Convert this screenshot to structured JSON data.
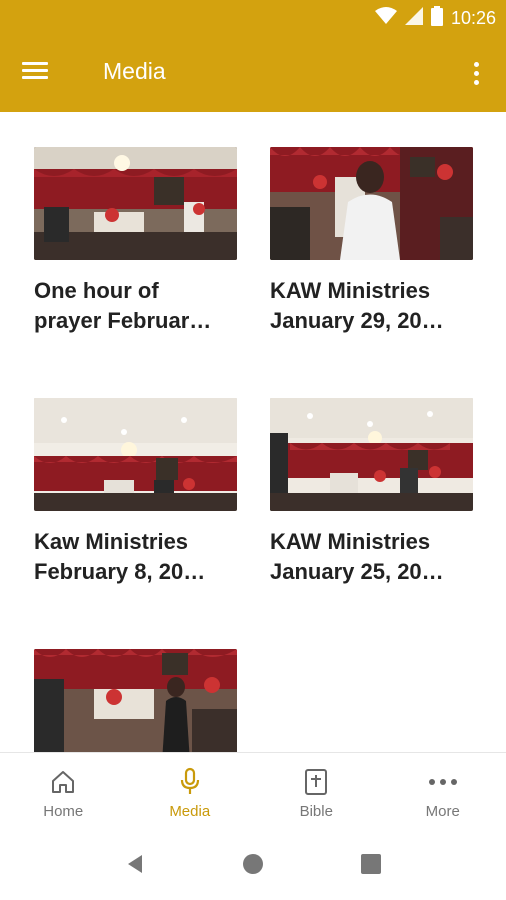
{
  "status": {
    "time": "10:26"
  },
  "appbar": {
    "title": "Media"
  },
  "colors": {
    "accent": "#D3A20F",
    "active_nav": "#C99A0B"
  },
  "media": [
    {
      "title_line1": "One hour of",
      "title_line2": "prayer Februar…"
    },
    {
      "title_line1": "KAW Ministries",
      "title_line2": "January 29, 20…"
    },
    {
      "title_line1": "Kaw Ministries",
      "title_line2": "February 8, 20…"
    },
    {
      "title_line1": "KAW Ministries",
      "title_line2": "January 25, 20…"
    },
    {
      "title_line1": "",
      "title_line2": ""
    }
  ],
  "bottom_nav": [
    {
      "label": "Home",
      "icon": "home-icon"
    },
    {
      "label": "Media",
      "icon": "microphone-icon",
      "active": true
    },
    {
      "label": "Bible",
      "icon": "bible-icon"
    },
    {
      "label": "More",
      "icon": "more-icon"
    }
  ]
}
